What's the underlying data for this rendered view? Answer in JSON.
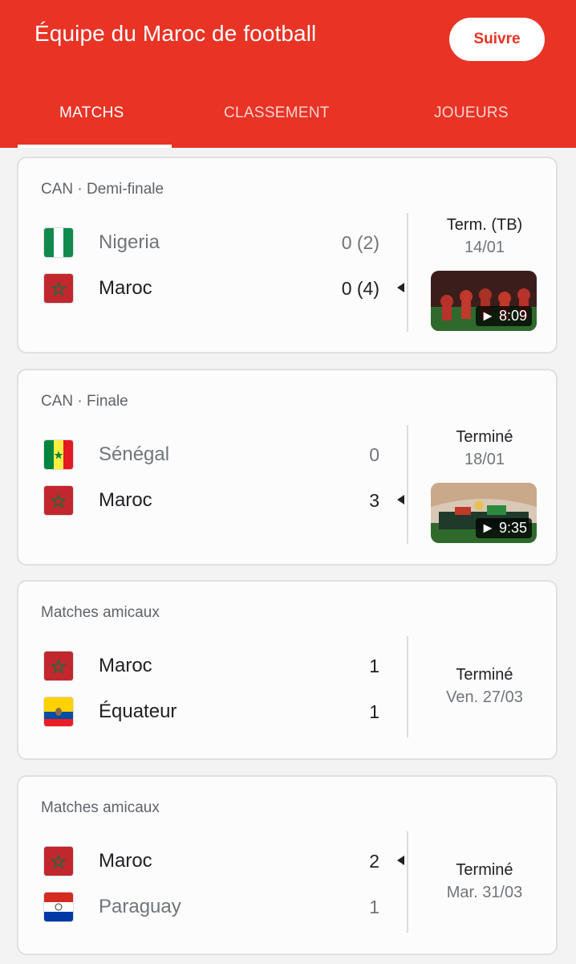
{
  "header": {
    "title": "Équipe du Maroc de football",
    "follow_label": "Suivre",
    "tabs": [
      {
        "label": "MATCHS",
        "active": true
      },
      {
        "label": "CLASSEMENT",
        "active": false
      },
      {
        "label": "JOUEURS",
        "active": false
      }
    ],
    "accent": "#e83325"
  },
  "matches": [
    {
      "competition": "CAN · Demi-finale",
      "team1": {
        "name": "Nigeria",
        "score": "0 (2)",
        "flag_icon": "nigeria-flag-icon"
      },
      "team2": {
        "name": "Maroc",
        "score": "0 (4)",
        "flag_icon": "morocco-flag-icon"
      },
      "status": "Term. (TB)",
      "date": "14/01",
      "video_duration": "► 8:09"
    },
    {
      "competition": "CAN · Finale",
      "team1": {
        "name": "Sénégal",
        "score": "0",
        "flag_icon": "senegal-flag-icon"
      },
      "team2": {
        "name": "Maroc",
        "score": "3",
        "flag_icon": "morocco-flag-icon"
      },
      "status": "Terminé",
      "date": "18/01",
      "video_duration": "► 9:35"
    },
    {
      "competition": "Matches amicaux",
      "team1": {
        "name": "Maroc",
        "score": "1",
        "flag_icon": "morocco-flag-icon"
      },
      "team2": {
        "name": "Équateur",
        "score": "1",
        "flag_icon": "ecuador-flag-icon"
      },
      "status": "Terminé",
      "date": "Ven. 27/03"
    },
    {
      "competition": "Matches amicaux",
      "team1": {
        "name": "Maroc",
        "score": "2",
        "flag_icon": "morocco-flag-icon"
      },
      "team2": {
        "name": "Paraguay",
        "score": "1",
        "flag_icon": "paraguay-flag-icon"
      },
      "status": "Terminé",
      "date": "Mar. 31/03"
    }
  ]
}
